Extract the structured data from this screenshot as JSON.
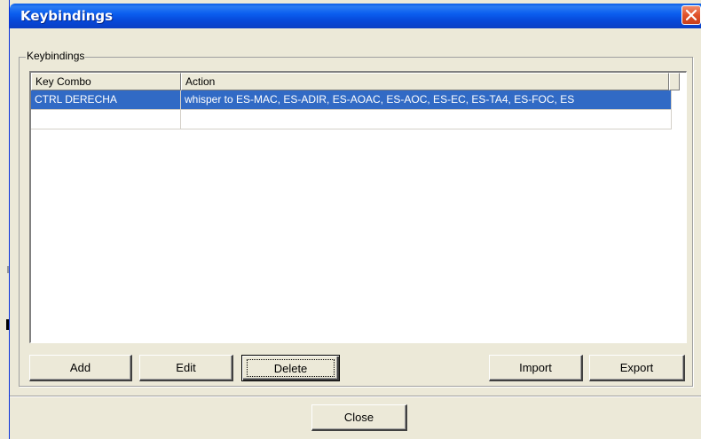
{
  "window": {
    "title": "Keybindings"
  },
  "group": {
    "label": "Keybindings"
  },
  "table": {
    "columns": [
      "Key Combo",
      "Action"
    ],
    "rows": [
      {
        "key": "CTRL DERECHA",
        "action": "whisper to ES-MAC, ES-ADIR, ES-AOAC, ES-AOC, ES-EC, ES-TA4, ES-FOC, ES"
      }
    ]
  },
  "buttons": {
    "add": "Add",
    "edit": "Edit",
    "delete": "Delete",
    "import": "Import",
    "export": "Export",
    "close": "Close"
  },
  "colors": {
    "selection": "#316ac5",
    "titlebar": "#0b5ff0",
    "close_button": "#e0522a"
  }
}
